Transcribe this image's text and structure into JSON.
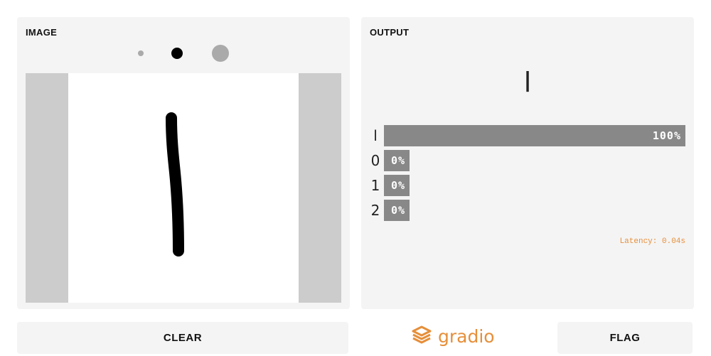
{
  "input": {
    "title": "IMAGE",
    "brushes": [
      "small",
      "medium",
      "large"
    ]
  },
  "output": {
    "title": "OUTPUT",
    "prediction": "l",
    "confidences": [
      {
        "label": "l",
        "value_text": "100%",
        "value": 1.0
      },
      {
        "label": "0",
        "value_text": "0%",
        "value": 0.0
      },
      {
        "label": "1",
        "value_text": "0%",
        "value": 0.0
      },
      {
        "label": "2",
        "value_text": "0%",
        "value": 0.0
      }
    ],
    "latency": "Latency: 0.04s"
  },
  "buttons": {
    "clear": "CLEAR",
    "flag": "FLAG"
  },
  "brand": {
    "name": "gradio",
    "color": "#e68f3a",
    "icon": "gradio-logo-icon"
  },
  "colors": {
    "panel": "#f4f4f4",
    "bar": "#888888",
    "canvas_border": "#cccccc"
  }
}
